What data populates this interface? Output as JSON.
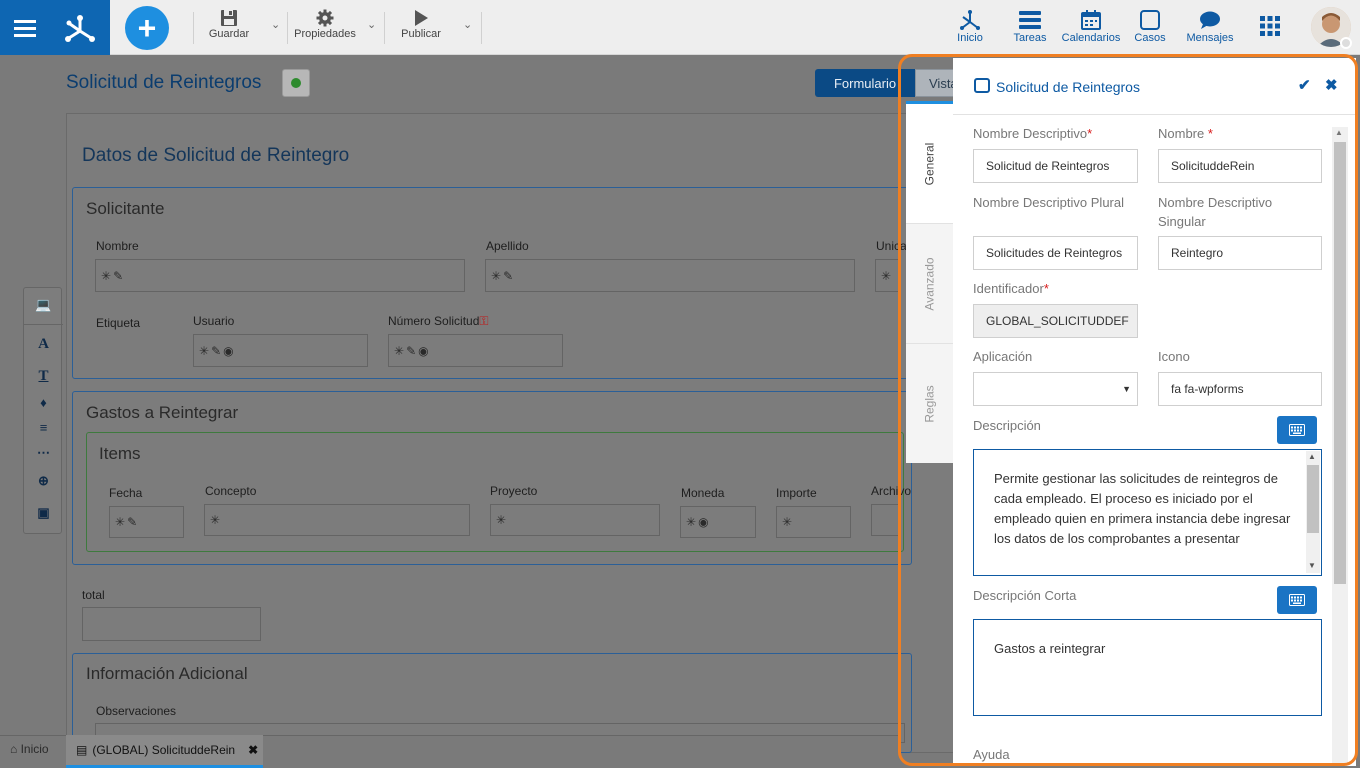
{
  "toolbar": {
    "save_label": "Guardar",
    "properties_label": "Propiedades",
    "publish_label": "Publicar"
  },
  "nav": {
    "inicio": "Inicio",
    "tareas": "Tareas",
    "calendarios": "Calendarios",
    "casos": "Casos",
    "mensajes": "Mensajes"
  },
  "page": {
    "title": "Solicitud de Reintegros",
    "view_form": "Formulario",
    "view_vista": "Vista"
  },
  "form": {
    "heading": "Datos de Solicitud de Reintegro",
    "solicitante": {
      "title": "Solicitante",
      "nombre": "Nombre",
      "apellido": "Apellido",
      "unica": "Unica",
      "etiqueta": "Etiqueta",
      "usuario": "Usuario",
      "numero": "Número Solicitud"
    },
    "gastos": {
      "title": "Gastos a Reintegrar",
      "items_title": "Items",
      "fecha": "Fecha",
      "concepto": "Concepto",
      "proyecto": "Proyecto",
      "moneda": "Moneda",
      "importe": "Importe",
      "archivo": "Archivo"
    },
    "total": "total",
    "info": {
      "title": "Información Adicional",
      "observaciones": "Observaciones"
    }
  },
  "bottombar": {
    "inicio": "Inicio",
    "tab": "(GLOBAL) SolicituddeRein"
  },
  "panel": {
    "title": "Solicitud de Reintegros",
    "tabs": [
      "General",
      "Avanzado",
      "Reglas"
    ],
    "nombre_descriptivo_label": "Nombre Descriptivo",
    "nombre_descriptivo_value": "Solicitud de Reintegros",
    "nombre_label": "Nombre ",
    "nombre_value": "SolicituddeRein",
    "plural_label": "Nombre Descriptivo Plural",
    "plural_value": "Solicitudes de Reintegros",
    "singular_label": "Nombre Descriptivo Singular",
    "singular_value": "Reintegro",
    "identificador_label": "Identificador",
    "identificador_value": "GLOBAL_SOLICITUDDEF",
    "aplicacion_label": "Aplicación",
    "aplicacion_value": "",
    "icono_label": "Icono",
    "icono_value": "fa fa-wpforms",
    "descripcion_label": "Descripción",
    "descripcion_value": "Permite gestionar las solicitudes de reintegros de cada empleado. El proceso es iniciado por el empleado quien en primera instancia debe ingresar los datos de los comprobantes a presentar",
    "descripcion_corta_label": "Descripción Corta",
    "descripcion_corta_value": "Gastos a reintegrar",
    "ayuda_label": "Ayuda",
    "required_mark": "*"
  },
  "colors": {
    "brand_blue": "#0e66b2",
    "highlight_orange": "#f07f22",
    "link_blue": "#0e5aa3"
  }
}
